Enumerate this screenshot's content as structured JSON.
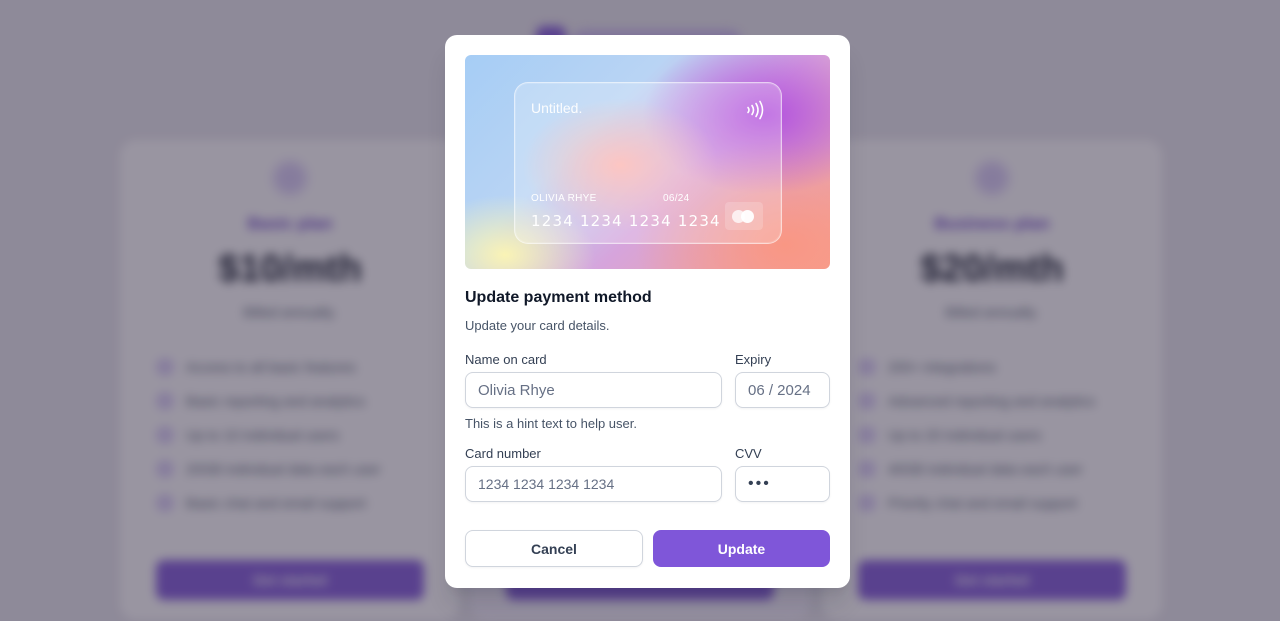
{
  "background": {
    "plans": [
      {
        "name": "Basic plan",
        "price": "$10/mth",
        "billing": "Billed annually.",
        "features": [
          "Access to all basic features",
          "Basic reporting and analytics",
          "Up to 10 individual users",
          "20GB individual data each user",
          "Basic chat and email support"
        ],
        "button": "Get started"
      },
      {
        "name": "Business plan",
        "price": "$20/mth",
        "billing": "Billed annually.",
        "features": [
          "200+ integrations",
          "Advanced reporting and analytics",
          "Up to 20 individual users",
          "40GB individual data each user",
          "Priority chat and email support"
        ],
        "button": "Get started"
      }
    ]
  },
  "modal": {
    "card": {
      "brand": "Untitled.",
      "holder": "OLIVIA RHYE",
      "expiry": "06/24",
      "number": "1234 1234 1234 1234"
    },
    "title": "Update payment method",
    "subtitle": "Update your card details.",
    "fields": {
      "name_label": "Name on card",
      "name_value": "Olivia Rhye",
      "name_hint": "This is a hint text to help user.",
      "expiry_label": "Expiry",
      "expiry_value": "06 / 2024",
      "number_label": "Card number",
      "number_value": "1234 1234 1234 1234",
      "cvv_label": "CVV",
      "cvv_value": "•••"
    },
    "buttons": {
      "cancel": "Cancel",
      "update": "Update"
    }
  },
  "colors": {
    "primary": "#7f56d9",
    "text_heading": "#101828",
    "text_muted": "#475467",
    "border": "#d0d5dd"
  },
  "icons": [
    "contactless-icon",
    "mastercard-icon",
    "check-icon",
    "plan-icon"
  ]
}
